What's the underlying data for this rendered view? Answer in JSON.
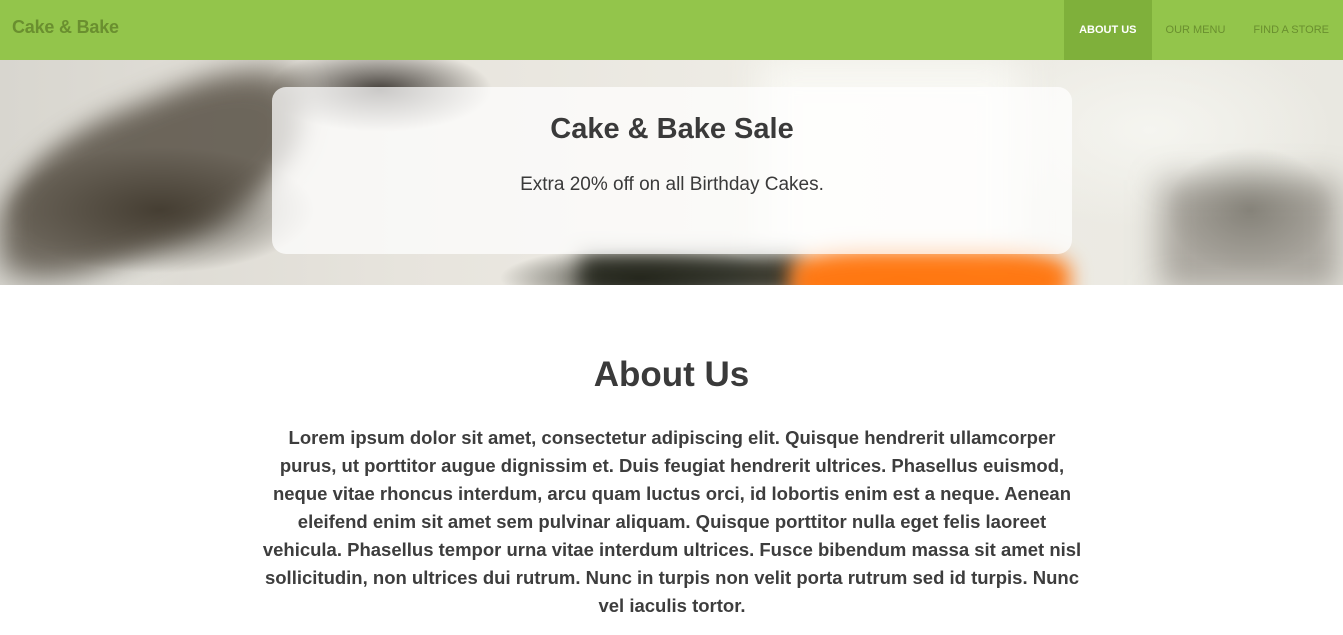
{
  "navbar": {
    "brand": "Cake & Bake",
    "items": [
      {
        "label": "ABOUT US",
        "active": true
      },
      {
        "label": "OUR MENU",
        "active": false
      },
      {
        "label": "FIND A STORE",
        "active": false
      }
    ],
    "color": "#93c54b"
  },
  "hero": {
    "title": "Cake & Bake Sale",
    "subtitle": "Extra 20% off on all Birthday Cakes."
  },
  "about": {
    "title": "About Us",
    "text": "Lorem ipsum dolor sit amet, consectetur adipiscing elit. Quisque hendrerit ullamcorper purus, ut porttitor augue dignissim et. Duis feugiat hendrerit ultrices. Phasellus euismod, neque vitae rhoncus interdum, arcu quam luctus orci, id lobortis enim est a neque. Aenean eleifend enim sit amet sem pulvinar aliquam. Quisque porttitor nulla eget felis laoreet vehicula. Phasellus tempor urna vitae interdum ultrices. Fusce bibendum massa sit amet nisl sollicitudin, non ultrices dui rutrum. Nunc in turpis non velit porta rutrum sed id turpis. Nunc vel iaculis tortor."
  }
}
